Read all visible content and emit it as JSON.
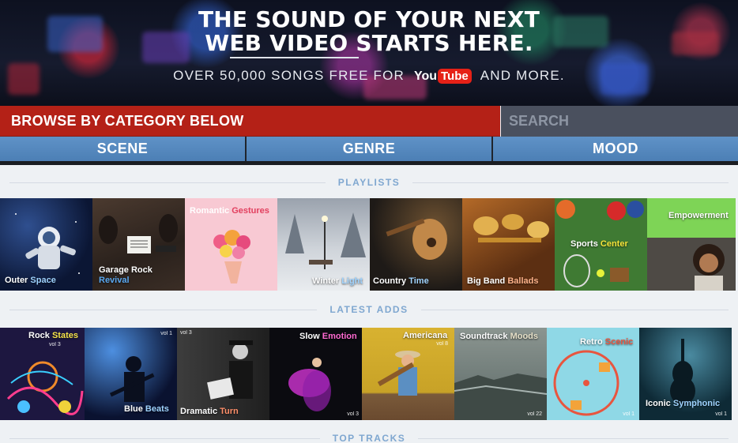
{
  "hero": {
    "title_line1": "THE SOUND OF YOUR NEXT",
    "title_line2": "WEB VIDEO STARTS HERE.",
    "subtitle_before": "OVER 50,000 SONGS FREE FOR",
    "youtube_you": "You",
    "youtube_tube": "Tube",
    "subtitle_after": "AND MORE."
  },
  "browse": {
    "label": "BROWSE BY CATEGORY BELOW"
  },
  "search": {
    "placeholder": "SEARCH"
  },
  "tabs": [
    {
      "label": "SCENE"
    },
    {
      "label": "GENRE"
    },
    {
      "label": "MOOD"
    }
  ],
  "sections": {
    "playlists": "PLAYLISTS",
    "latest": "LATEST ADDS",
    "top_tracks": "TOP TRACKS"
  },
  "playlists": [
    {
      "w1": "Outer",
      "w2": "Space"
    },
    {
      "w1": "Garage Rock",
      "w2": "Revival"
    },
    {
      "w1": "Romantic",
      "w2": "Gestures"
    },
    {
      "w1": "Winter",
      "w2": "Light"
    },
    {
      "w1": "Country",
      "w2": "Time"
    },
    {
      "w1": "Big Band",
      "w2": "Ballads"
    },
    {
      "w1": "Sports",
      "w2": "Center"
    },
    {
      "w1": "Empowerment",
      "w2": ""
    }
  ],
  "latest": [
    {
      "w1": "Rock",
      "w2": "States",
      "vol": "vol 3"
    },
    {
      "w1": "Blue",
      "w2": "Beats",
      "vol": "vol 1"
    },
    {
      "w1": "Dramatic",
      "w2": "Turn",
      "vol": "vol 3"
    },
    {
      "w1": "Slow",
      "w2": "Emotion",
      "vol": "vol 3"
    },
    {
      "w1": "Americana",
      "w2": "",
      "vol": "vol 8"
    },
    {
      "w1": "Soundtrack",
      "w2": "Moods",
      "vol": "vol 22"
    },
    {
      "w1": "Retro",
      "w2": "Scenic",
      "vol": "vol 1"
    },
    {
      "w1": "Iconic",
      "w2": "Symphonic",
      "vol": "vol 1"
    }
  ],
  "colors": {
    "accent_red": "#b42117",
    "tab_blue": "#5a8dc3",
    "section_blue": "#7fa7d0"
  }
}
